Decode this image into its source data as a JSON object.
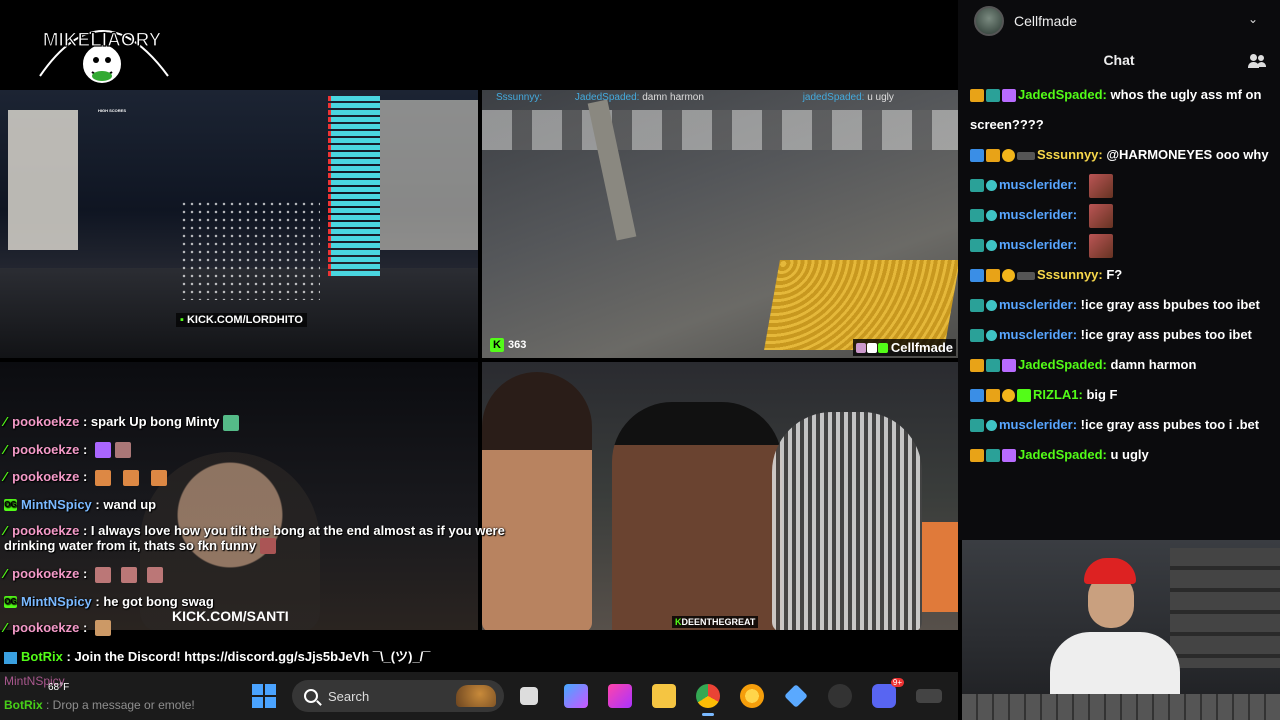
{
  "logo": {
    "text": "MIKELIAORY"
  },
  "tile_tl": {
    "kick_url": "KICK.COM/LORDHITO",
    "leaderboard_title": "HIGH SCORES"
  },
  "tile_tr": {
    "overlay_chat": [
      {
        "name": "Sssunnyy:",
        "text": ""
      },
      {
        "name": "JadedSpaded:",
        "text": "damn harmon"
      },
      {
        "name": "jadedSpaded:",
        "text": "u ugly"
      }
    ],
    "viewers": "363",
    "streamer_tag": "Cellfmade"
  },
  "tile_bl": {
    "kick_url": "KICK.COM/SANTI"
  },
  "tile_br": {
    "tag": "DEENTHEGREAT"
  },
  "overlay_chat": [
    {
      "nick": "pookoekze",
      "sep": " : ",
      "text": "spark Up bong Minty",
      "icon": "slash"
    },
    {
      "nick": "pookoekze",
      "sep": " : ",
      "text": "",
      "icon": "slash"
    },
    {
      "nick": "pookoekze",
      "sep": " : ",
      "text": "",
      "icon": "slash"
    },
    {
      "nick": "MintNSpicy",
      "sep": " : ",
      "text": "wand up",
      "icon": "badge"
    },
    {
      "nick": "pookoekze",
      "sep": " : ",
      "text": "I always love how you tilt the bong at the end almost as if you were drinking water from it, thats so fkn funny",
      "icon": "slash"
    },
    {
      "nick": "pookoekze",
      "sep": " : ",
      "text": "",
      "icon": "slash"
    },
    {
      "nick": "MintNSpicy",
      "sep": " : ",
      "text": "he got bong swag",
      "icon": "badge"
    },
    {
      "nick": "pookoekze",
      "sep": " : ",
      "text": "",
      "icon": "slash"
    }
  ],
  "botrix": {
    "nick": "BotRix",
    "text": " : Join the Discord! https://discord.gg/sJjs5bJeVh ¯\\_(ツ)_/¯"
  },
  "taskbar": {
    "ghost_nick": "MintNSpicy",
    "ghost_nick2": "BotRix",
    "ghost_text2": ": Drop a message or emote!",
    "temperature": "68°F",
    "search_placeholder": "Search",
    "discord_badge": "9+"
  },
  "right_panel": {
    "channel_name": "Cellfmade",
    "chat_title": "Chat",
    "messages": [
      {
        "badges": [
          "crown",
          "vip",
          "gift"
        ],
        "name": "JadedSpaded:",
        "color": "g",
        "text": " whos the ugly ass mf on screen????"
      },
      {
        "badges": [
          "blue",
          "crown",
          "coin",
          "dark"
        ],
        "name": "Sssunnyy:",
        "color": "y",
        "text": " @HARMONEYES ooo why"
      },
      {
        "badges": [
          "vip",
          "teal"
        ],
        "name": "musclerider:",
        "color": "b",
        "text": "",
        "emote": true
      },
      {
        "badges": [
          "vip",
          "teal"
        ],
        "name": "musclerider:",
        "color": "b",
        "text": "",
        "emote": true
      },
      {
        "badges": [
          "vip",
          "teal"
        ],
        "name": "musclerider:",
        "color": "b",
        "text": "",
        "emote": true
      },
      {
        "badges": [
          "blue",
          "crown",
          "coin",
          "dark"
        ],
        "name": "Sssunnyy:",
        "color": "y",
        "text": " F?"
      },
      {
        "badges": [
          "vip",
          "teal"
        ],
        "name": "musclerider:",
        "color": "b",
        "text": " !ice gray ass bpubes too ibet"
      },
      {
        "badges": [
          "vip",
          "teal"
        ],
        "name": "musclerider:",
        "color": "b",
        "text": " !ice gray ass pubes too ibet"
      },
      {
        "badges": [
          "crown",
          "vip",
          "gift"
        ],
        "name": "JadedSpaded:",
        "color": "g",
        "text": " damn harmon"
      },
      {
        "badges": [
          "blue",
          "crown",
          "coin",
          "green"
        ],
        "name": "RIZLA1:",
        "color": "g",
        "text": " big F"
      },
      {
        "badges": [
          "vip",
          "teal"
        ],
        "name": "musclerider:",
        "color": "b",
        "text": " !ice gray ass pubes too i .bet"
      },
      {
        "badges": [
          "crown",
          "vip",
          "gift"
        ],
        "name": "JadedSpaded:",
        "color": "g",
        "text": " u ugly"
      }
    ]
  },
  "colors": {
    "kick_green": "#53fc18",
    "pink_nick": "#f49ac8",
    "blue_nick": "#58a6ff"
  }
}
